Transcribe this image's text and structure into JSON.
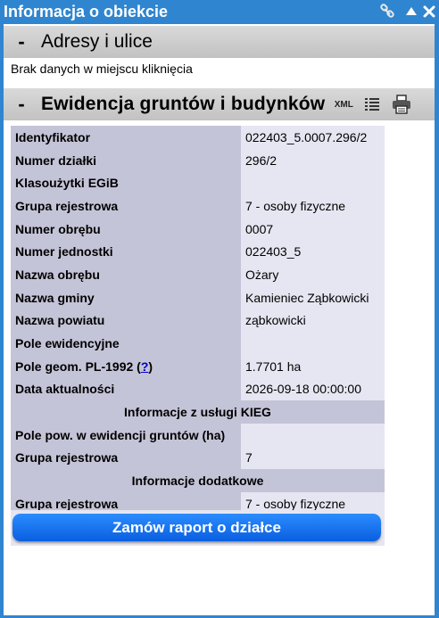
{
  "window": {
    "title": "Informacja o obiekcie"
  },
  "addresses": {
    "toggle": "-",
    "title": "Adresy i ulice",
    "message": "Brak danych w miejscu kliknięcia"
  },
  "registry": {
    "toggle": "-",
    "title": "Ewidencja gruntów i budynków",
    "xml_label": "XML",
    "rows": [
      {
        "label": "Identyfikator",
        "value": "022403_5.0007.296/2"
      },
      {
        "label": "Numer działki",
        "value": "296/2"
      },
      {
        "label": "Klasoużytki EGiB",
        "value": ""
      },
      {
        "label": "Grupa rejestrowa",
        "value": "7 - osoby fizyczne"
      },
      {
        "label": "Numer obrębu",
        "value": "0007"
      },
      {
        "label": "Numer jednostki",
        "value": "022403_5"
      },
      {
        "label": "Nazwa obrębu",
        "value": "Ożary"
      },
      {
        "label": "Nazwa gminy",
        "value": "Kamieniec Ząbkowicki"
      },
      {
        "label": "Nazwa powiatu",
        "value": "ząbkowicki"
      },
      {
        "label": "Pole ewidencyjne",
        "value": ""
      },
      {
        "label": "Pole geom. PL-1992 (",
        "help": "?",
        "label_end": ")",
        "value": "1.7701 ha"
      },
      {
        "label": "Data aktualności",
        "value": "2026-09-18 00:00:00"
      }
    ],
    "kieg_header": "Informacje z usługi KIEG",
    "kieg_rows": [
      {
        "label": "Pole pow. w ewidencji gruntów (ha)",
        "value": ""
      },
      {
        "label": "Grupa rejestrowa",
        "value": "7"
      }
    ],
    "extra_header": "Informacje dodatkowe",
    "extra_rows": [
      {
        "label": "Grupa rejestrowa",
        "value": "7 - osoby fizyczne"
      }
    ],
    "order_button": "Zamów raport o działce"
  },
  "icons": [
    "link-icon",
    "collapse-up-icon",
    "close-icon",
    "list-icon",
    "printer-icon"
  ]
}
